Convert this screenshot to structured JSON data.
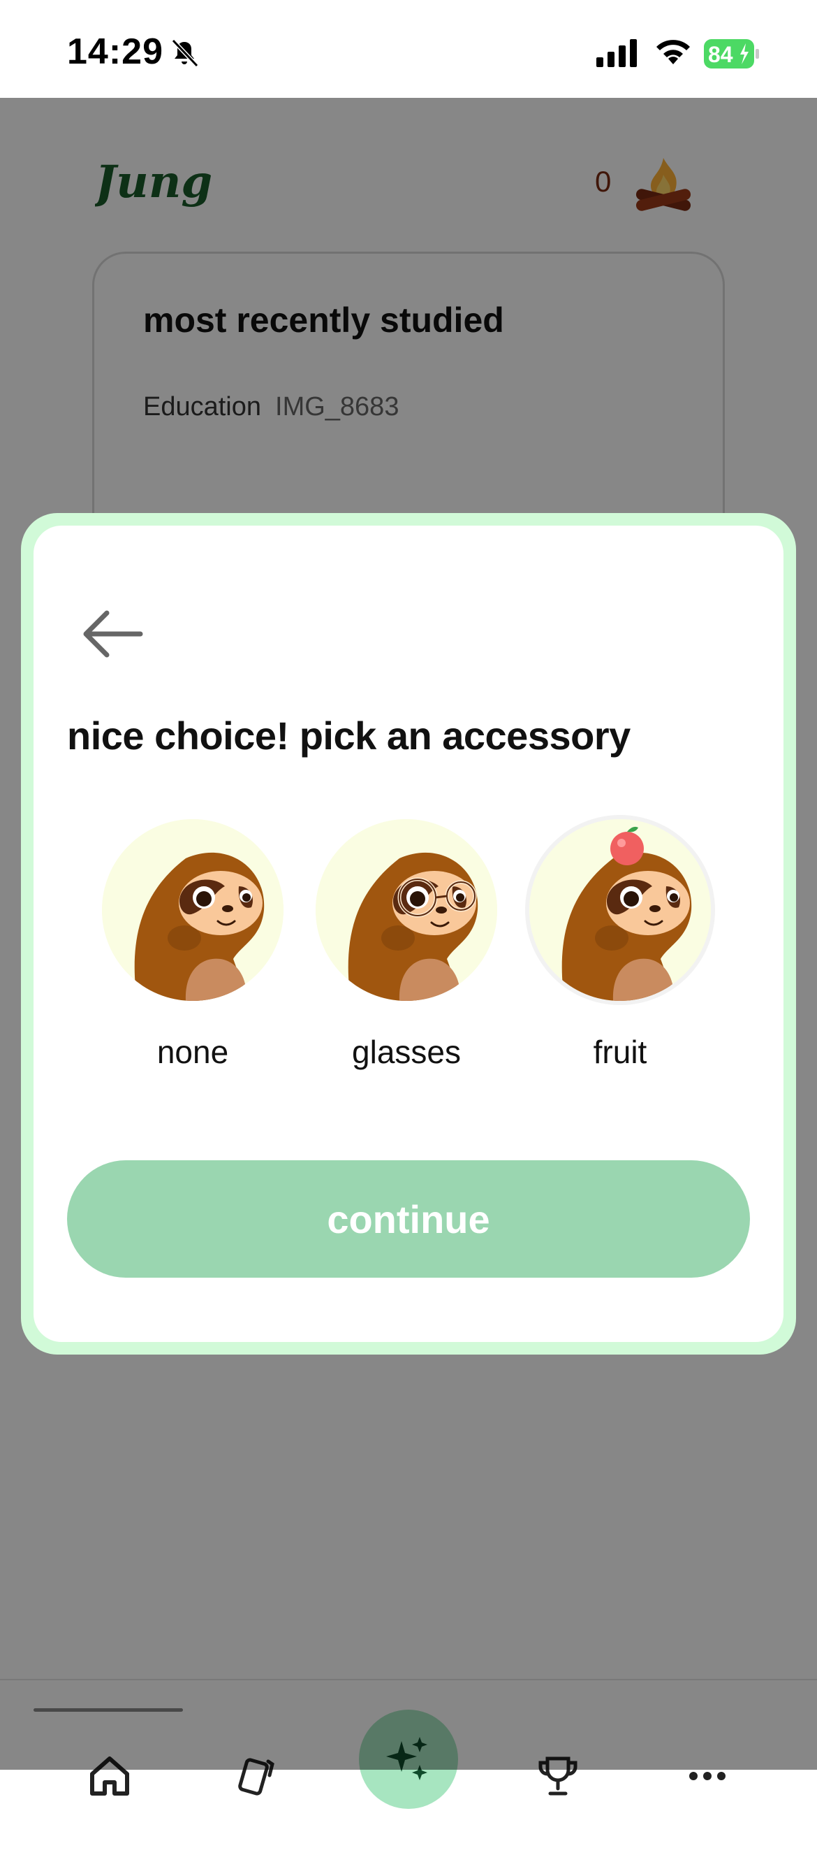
{
  "status_bar": {
    "time": "14:29",
    "battery_percent": "84",
    "icons": [
      "bell-slash-icon",
      "cellular-signal-icon",
      "wifi-icon",
      "battery-charging-icon"
    ]
  },
  "header": {
    "logo_text": "Jungle",
    "streak_count": "0",
    "streak_icon": "campfire-icon"
  },
  "recent_card": {
    "title": "most recently studied",
    "category": "Education",
    "file_name": "IMG_8683"
  },
  "modal": {
    "back_icon": "arrow-left-icon",
    "title": "nice choice! pick an accessory",
    "options": [
      {
        "label": "none",
        "accessory": "none"
      },
      {
        "label": "glasses",
        "accessory": "glasses"
      },
      {
        "label": "fruit",
        "accessory": "fruit"
      }
    ],
    "selected_option": "fruit",
    "continue_label": "continue"
  },
  "bottom_nav": {
    "items": [
      {
        "icon": "home-icon"
      },
      {
        "icon": "flashcards-icon"
      },
      {
        "icon": "sparkles-icon"
      },
      {
        "icon": "trophy-icon"
      },
      {
        "icon": "more-dots-icon"
      }
    ]
  },
  "colors": {
    "modal_border": "#d1fad8",
    "continue_button": "#9ad6b0",
    "avatar_bg": "#fafde2",
    "sloth_fur": "#a0560f",
    "overlay": "rgba(0,0,0,0.47)"
  }
}
